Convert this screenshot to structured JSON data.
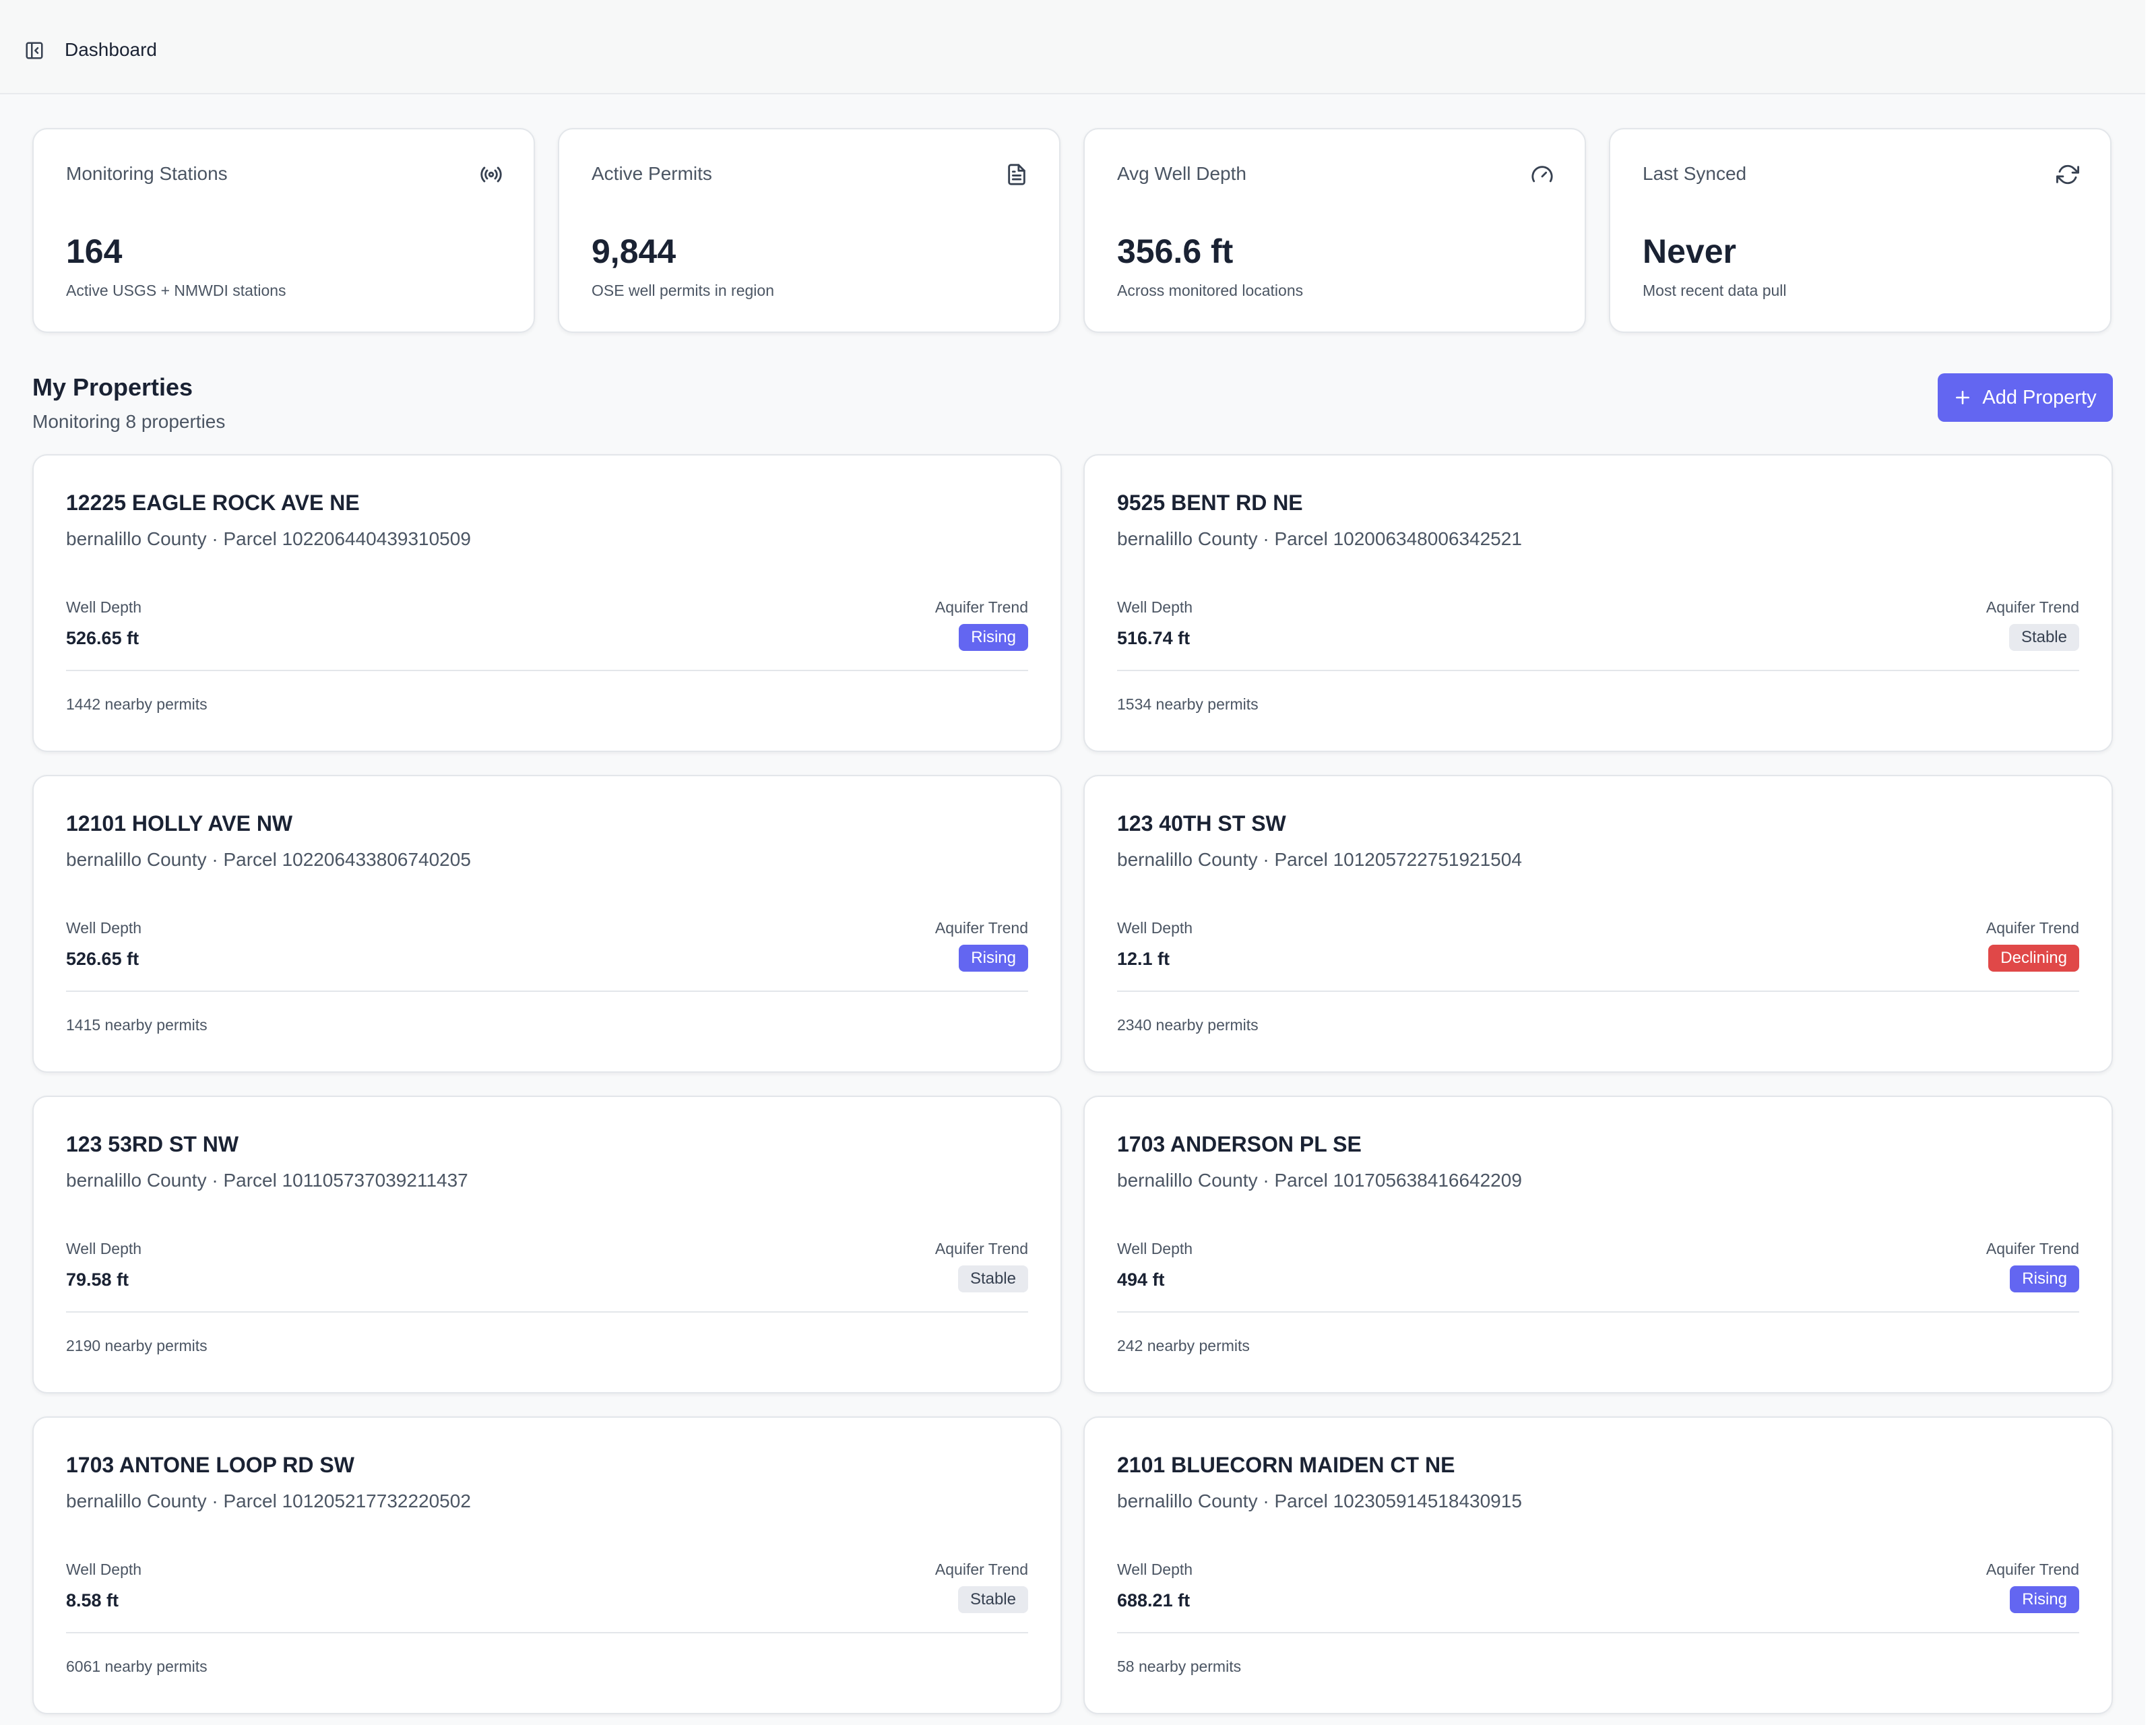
{
  "topbar": {
    "title": "Dashboard"
  },
  "stats": [
    {
      "label": "Monitoring Stations",
      "value": "164",
      "sub": "Active USGS + NMWDI stations",
      "icon": "radio-signal-icon"
    },
    {
      "label": "Active Permits",
      "value": "9,844",
      "sub": "OSE well permits in region",
      "icon": "document-icon"
    },
    {
      "label": "Avg Well Depth",
      "value": "356.6 ft",
      "sub": "Across monitored locations",
      "icon": "gauge-icon"
    },
    {
      "label": "Last Synced",
      "value": "Never",
      "sub": "Most recent data pull",
      "icon": "refresh-icon"
    }
  ],
  "section": {
    "title": "My Properties",
    "subtitle": "Monitoring 8 properties",
    "add_button": "Add Property"
  },
  "labels": {
    "well_depth": "Well Depth",
    "aquifer_trend": "Aquifer Trend"
  },
  "properties": [
    {
      "address": "12225 EAGLE ROCK AVE NE",
      "meta": "bernalillo County · Parcel 102206440439310509",
      "depth": "526.65 ft",
      "trend": "Rising",
      "permits": "1442 nearby permits"
    },
    {
      "address": "9525 BENT RD NE",
      "meta": "bernalillo County · Parcel 102006348006342521",
      "depth": "516.74 ft",
      "trend": "Stable",
      "permits": "1534 nearby permits"
    },
    {
      "address": "12101 HOLLY AVE NW",
      "meta": "bernalillo County · Parcel 102206433806740205",
      "depth": "526.65 ft",
      "trend": "Rising",
      "permits": "1415 nearby permits"
    },
    {
      "address": "123 40TH ST SW",
      "meta": "bernalillo County · Parcel 101205722751921504",
      "depth": "12.1 ft",
      "trend": "Declining",
      "permits": "2340 nearby permits"
    },
    {
      "address": "123 53RD ST NW",
      "meta": "bernalillo County · Parcel 101105737039211437",
      "depth": "79.58 ft",
      "trend": "Stable",
      "permits": "2190 nearby permits"
    },
    {
      "address": "1703 ANDERSON PL SE",
      "meta": "bernalillo County · Parcel 101705638416642209",
      "depth": "494 ft",
      "trend": "Rising",
      "permits": "242 nearby permits"
    },
    {
      "address": "1703 ANTONE LOOP RD SW",
      "meta": "bernalillo County · Parcel 101205217732220502",
      "depth": "8.58 ft",
      "trend": "Stable",
      "permits": "6061 nearby permits"
    },
    {
      "address": "2101 BLUECORN MAIDEN CT NE",
      "meta": "bernalillo County · Parcel 102305914518430915",
      "depth": "688.21 ft",
      "trend": "Rising",
      "permits": "58 nearby permits"
    }
  ],
  "colors": {
    "accent": "#6366f1",
    "declining": "#e04848",
    "stable_bg": "#e8eaef"
  }
}
